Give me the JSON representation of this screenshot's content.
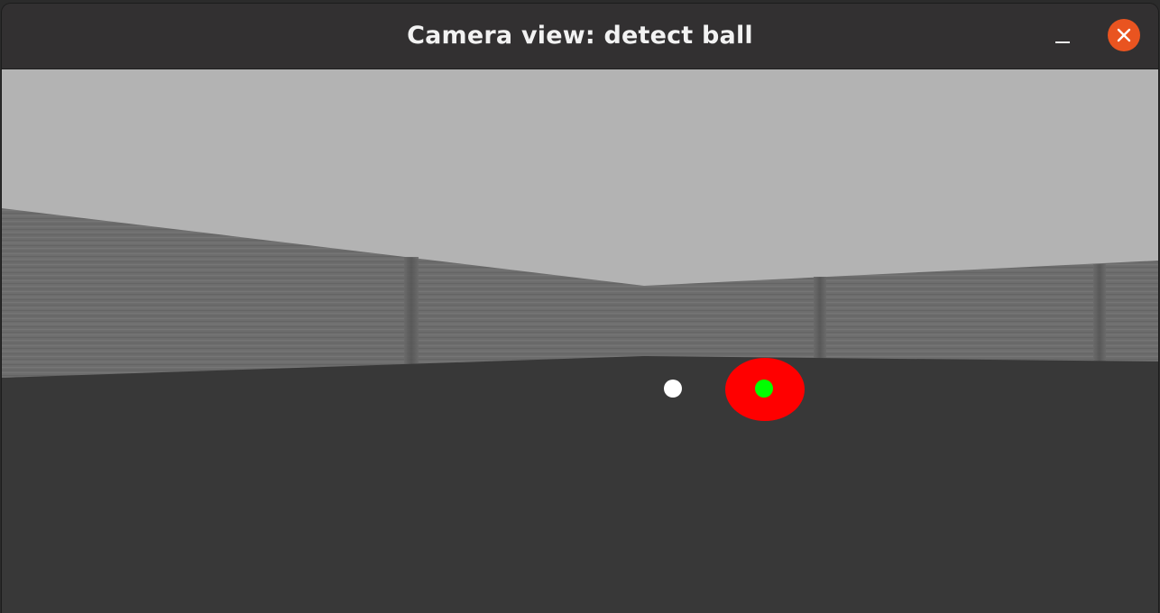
{
  "window": {
    "title": "Camera view: detect ball"
  },
  "controls": {
    "minimize_icon": "minimize-icon",
    "close_icon": "close-icon",
    "close_color": "#e95420"
  },
  "scene": {
    "sky_color": "#b3b3b3",
    "wall_color": "#6e6e6e",
    "floor_color": "#383838",
    "ball_color": "#ff0000",
    "ball_center_marker_color": "#00ff00",
    "image_center_marker_color": "#ffffff"
  }
}
